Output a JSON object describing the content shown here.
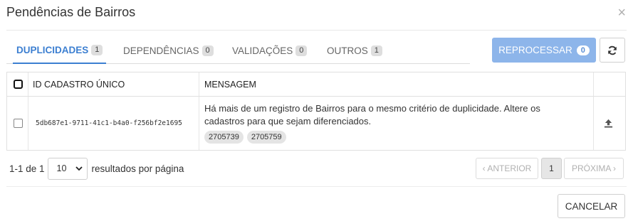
{
  "dialog": {
    "title": "Pendências de Bairros",
    "close_glyph": "×"
  },
  "tabs": [
    {
      "label": "DUPLICIDADES",
      "count": "1",
      "active": true
    },
    {
      "label": "DEPENDÊNCIAS",
      "count": "0",
      "active": false
    },
    {
      "label": "VALIDAÇÕES",
      "count": "0",
      "active": false
    },
    {
      "label": "OUTROS",
      "count": "1",
      "active": false
    }
  ],
  "actions": {
    "reprocess_label": "REPROCESSAR",
    "reprocess_count": "0",
    "refresh_icon": "refresh-icon"
  },
  "table": {
    "columns": [
      "ID CADASTRO ÚNICO",
      "MENSAGEM"
    ],
    "rows": [
      {
        "id": "5db687e1-9711-41c1-b4a0-f256bf2e1695",
        "message": "Há mais de um registro de Bairros para o mesmo critério de duplicidade. Altere os cadastros para que sejam diferenciados.",
        "chips": [
          "2705739",
          "2705759"
        ],
        "action_icon": "upload-icon"
      }
    ]
  },
  "pagination": {
    "range": "1-1 de 1",
    "page_size": "10",
    "page_size_suffix": "resultados por página",
    "prev_label": "‹ ANTERIOR",
    "current_page": "1",
    "next_label": "PRÓXIMA ›"
  },
  "footer": {
    "cancel_label": "CANCELAR"
  },
  "colors": {
    "accent": "#3c7fd1",
    "reprocess_bg": "#8db5ea"
  }
}
